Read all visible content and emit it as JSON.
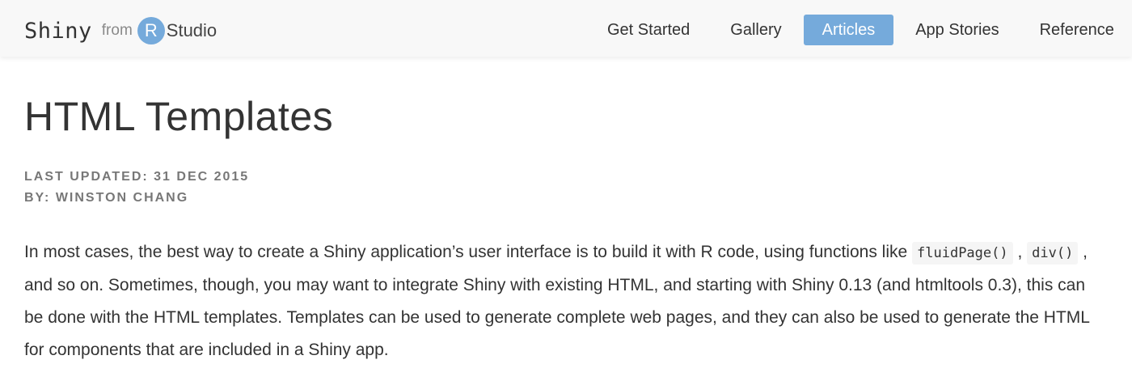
{
  "brand": {
    "shiny": "Shiny",
    "from": "from",
    "r_letter": "R",
    "studio": "Studio"
  },
  "nav": {
    "items": [
      {
        "label": "Get Started",
        "active": false
      },
      {
        "label": "Gallery",
        "active": false
      },
      {
        "label": "Articles",
        "active": true
      },
      {
        "label": "App Stories",
        "active": false
      },
      {
        "label": "Reference",
        "active": false
      }
    ]
  },
  "article": {
    "title": "HTML Templates",
    "last_updated": "Last updated: 31 Dec 2015",
    "author": "By: Winston Chang",
    "intro": {
      "text_1": "In most cases, the best way to create a Shiny application’s user interface is to build it with R code, using functions like ",
      "code_1": "fluidPage()",
      "sep": " , ",
      "code_2": "div()",
      "text_2": " , and so on. Sometimes, though, you may want to integrate Shiny with existing HTML, and starting with Shiny 0.13 (and htmltools 0.3), this can be done with the HTML templates. Templates can be used to generate complete web pages, and they can also be used to generate the HTML for components that are included in a Shiny app."
    }
  },
  "colors": {
    "accent": "#75aadb",
    "navbar_bg": "#f8f8f8",
    "text": "#333333",
    "meta": "#777777"
  }
}
